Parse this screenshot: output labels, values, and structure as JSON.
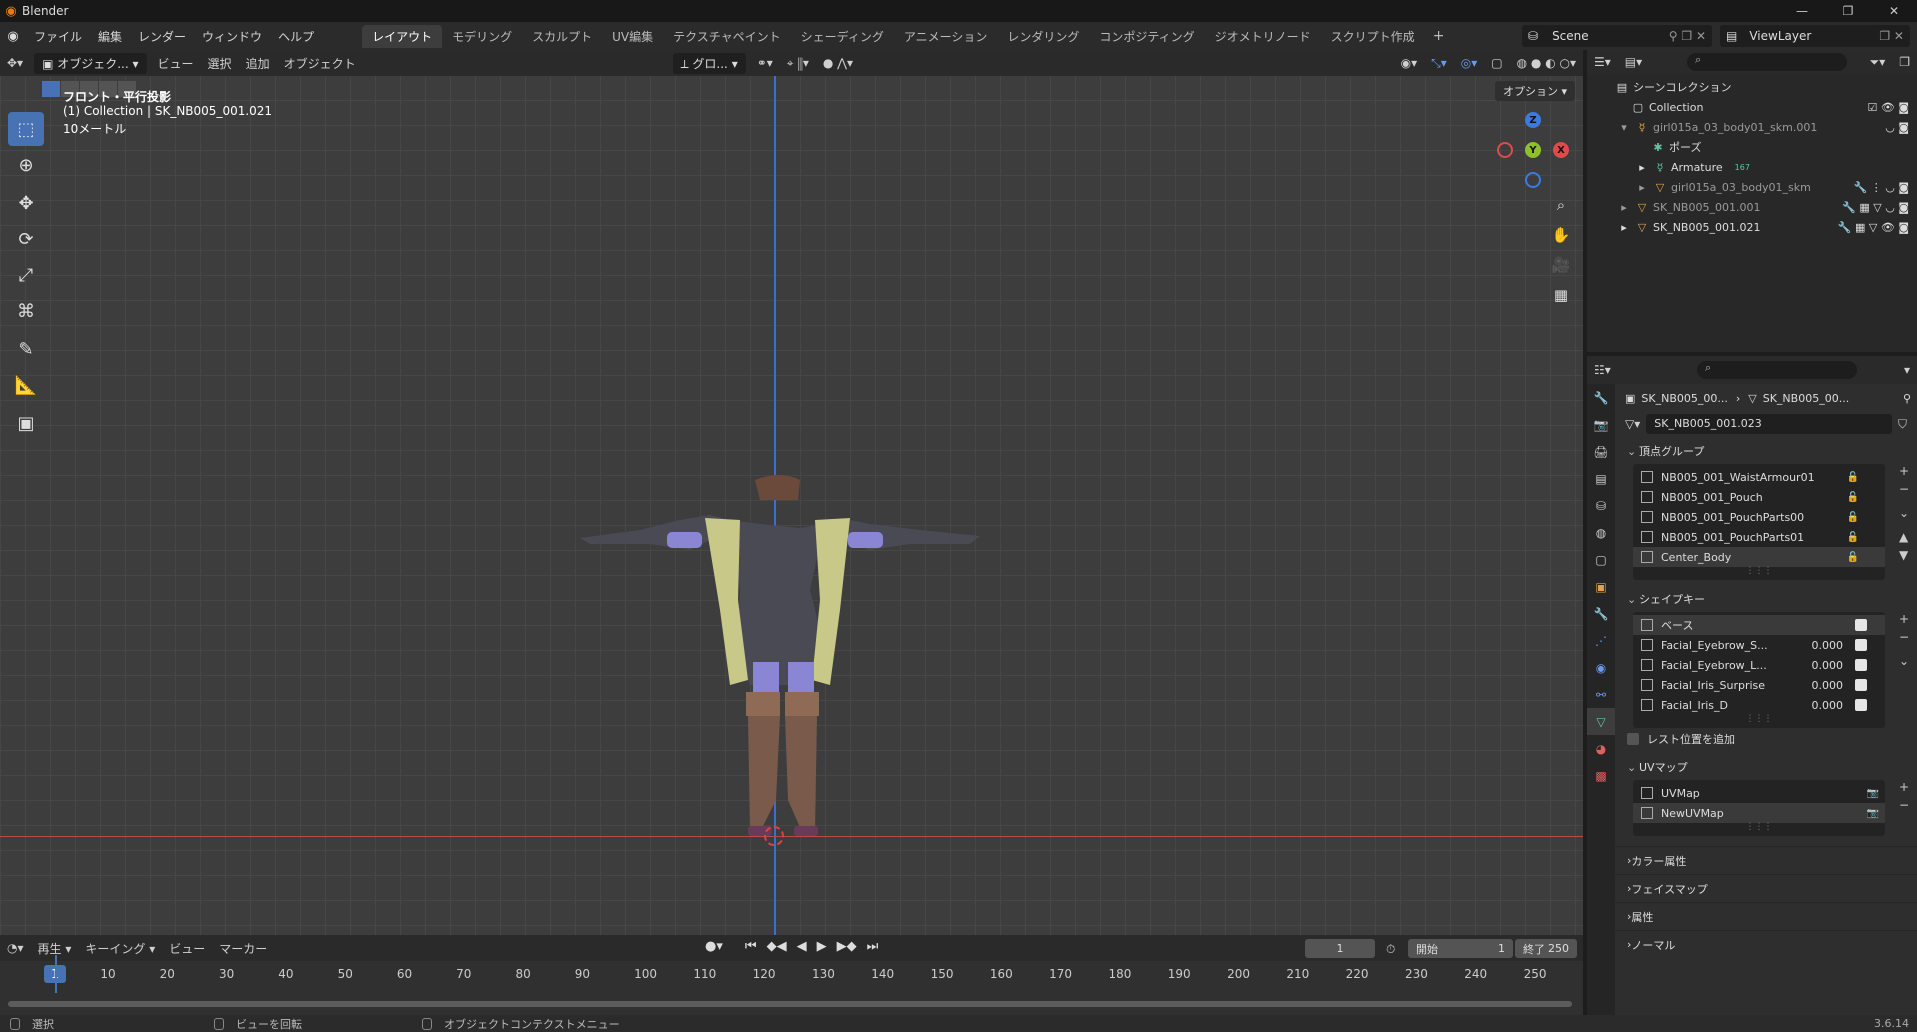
{
  "window": {
    "title": "Blender"
  },
  "menu": {
    "items": [
      "ファイル",
      "編集",
      "レンダー",
      "ウィンドウ",
      "ヘルプ"
    ]
  },
  "workspaces": {
    "tabs": [
      "レイアウト",
      "モデリング",
      "スカルプト",
      "UV編集",
      "テクスチャペイント",
      "シェーディング",
      "アニメーション",
      "レンダリング",
      "コンポジティング",
      "ジオメトリノード",
      "スクリプト作成"
    ],
    "active": "レイアウト"
  },
  "scene": {
    "name": "Scene",
    "view_layer": "ViewLayer"
  },
  "viewport": {
    "mode": "オブジェク...",
    "menus": [
      "ビュー",
      "選択",
      "追加",
      "オブジェクト"
    ],
    "orientation": "グロ...",
    "options": "オプション",
    "overlay": {
      "view_name": "フロント・平行投影",
      "collection": "(1) Collection | SK_NB005_001.021",
      "scale": "10メートル"
    },
    "gizmo": {
      "z": "Z",
      "y": "Y",
      "x": "X"
    }
  },
  "timeline": {
    "menus": [
      "再生",
      "キーイング",
      "ビュー",
      "マーカー"
    ],
    "current_frame": "1",
    "start_label": "開始",
    "start": "1",
    "end_label": "終了",
    "end": "250",
    "ticks": [
      "10",
      "20",
      "30",
      "40",
      "50",
      "60",
      "70",
      "80",
      "90",
      "100",
      "110",
      "120",
      "130",
      "140",
      "150",
      "160",
      "170",
      "180",
      "190",
      "200",
      "210",
      "220",
      "230",
      "240",
      "250"
    ]
  },
  "statusbar": {
    "select": "選択",
    "rotate": "ビューを回転",
    "context": "オブジェクトコンテクストメニュー",
    "version": "3.6.14"
  },
  "outliner": {
    "scene_collection": "シーンコレクション",
    "rows": [
      "Collection",
      "girl015a_03_body01_skm.001",
      "ポーズ",
      "Armature",
      "girl015a_03_body01_skm",
      "SK_NB005_001.001",
      "SK_NB005_001.021"
    ],
    "armature_badge": "167"
  },
  "properties": {
    "path_left": "SK_NB005_00...",
    "path_right": "SK_NB005_00...",
    "mesh_name": "SK_NB005_001.023",
    "vertex_groups": {
      "title": "頂点グループ",
      "items": [
        "NB005_001_WaistArmour01",
        "NB005_001_Pouch",
        "NB005_001_PouchParts00",
        "NB005_001_PouchParts01",
        "Center_Body"
      ]
    },
    "shape_keys": {
      "title": "シェイプキー",
      "items": [
        {
          "name": "ベース",
          "value": ""
        },
        {
          "name": "Facial_Eyebrow_S...",
          "value": "0.000"
        },
        {
          "name": "Facial_Eyebrow_L...",
          "value": "0.000"
        },
        {
          "name": "Facial_Iris_Surprise",
          "value": "0.000"
        },
        {
          "name": "Facial_Iris_D",
          "value": "0.000"
        }
      ],
      "rest_position": "レスト位置を追加"
    },
    "uv_maps": {
      "title": "UVマップ",
      "items": [
        "UVMap",
        "NewUVMap"
      ]
    },
    "collapsed_panels": [
      "カラー属性",
      "フェイスマップ",
      "属性",
      "ノーマル"
    ]
  }
}
